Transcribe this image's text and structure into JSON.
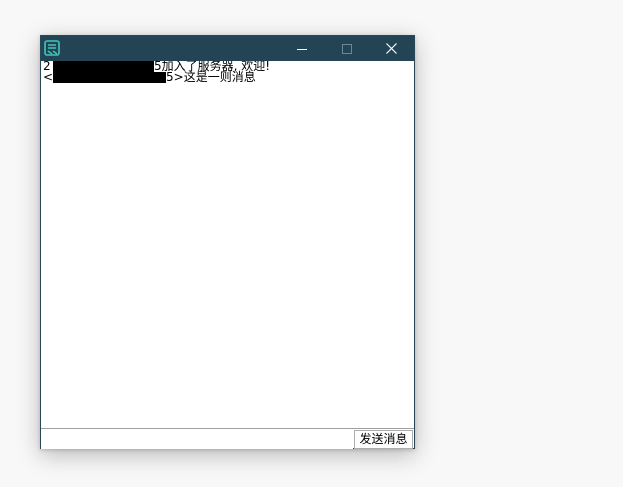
{
  "window": {
    "icon": "app-logo-icon",
    "controls": {
      "minimize": "minimize-icon",
      "maximize": "maximize-icon",
      "close": "close-icon"
    },
    "colors": {
      "titlebar": "#234454",
      "icon_accent": "#3fc6b8"
    }
  },
  "chat": {
    "messages": [
      {
        "prefix": "2",
        "redacted": true,
        "suffix": "5加入了服务器, 欢迎!"
      },
      {
        "prefix": "<2",
        "redacted": true,
        "suffix": "5>这是一则消息"
      }
    ]
  },
  "composer": {
    "input_value": "",
    "send_label": "发送消息"
  }
}
